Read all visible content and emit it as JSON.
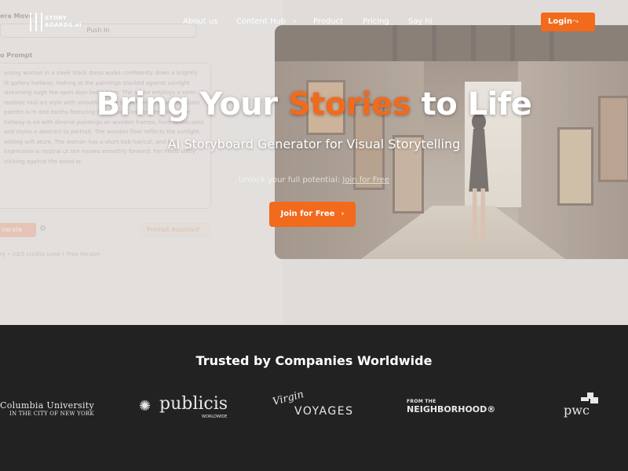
{
  "nav": {
    "logo_line1": "STORY",
    "logo_line2": "BOARDS.ai",
    "items": [
      "About us",
      "Content Hub",
      "Product",
      "Pricing",
      "Say hi"
    ],
    "content_hub_caret": "⌄",
    "login_label": "Login",
    "login_icon": "squiggle-arrow-icon"
  },
  "mockup": {
    "camera_label": "era Move",
    "motion_value": "Push In",
    "prompt_label": "o Prompt",
    "prompt_text": "young woman in a sleek black dress walks confidently down a brightly lit gallery hallway, looking at the paintings stacked against sunlight streaming ough the open door behind her. The scene employs a semi-realistic ntal art style with smooth textures and vibrant tones, the color palette is m and earthy featuring rich browns and golden hues. The hallway is ed with diverse paintings on wooden frames, from landscapes and styles n abstract to portrait. The wooden floor reflects the sunlight, adding soft ature. The woman has a short bob haircut, and her expression is neutral ut she moves smoothly forward, her heels softly clicking against the wood or.",
    "generate_label": "nerate",
    "prompt_assist_label": "Prompt Assistant",
    "credit_text": "ry • 03/5 credits used • Free Version"
  },
  "hero": {
    "title_before": "Bring Your ",
    "title_accent": "Stories",
    "title_after": " to Life",
    "subtitle": "AI Storyboard Generator for Visual Storytelling",
    "note_text": "Unlock your full potential: ",
    "note_link": "Join for Free",
    "cta_label": "Join for Free",
    "cta_icon": "chevron-right-icon"
  },
  "trusted": {
    "title": "Trusted by Companies Worldwide",
    "logos": {
      "columbia_line1": "Columbia University",
      "columbia_line2": "IN THE CITY OF NEW YORK",
      "publicis_name": "publicis",
      "publicis_sub": "WORLDWIDE",
      "virgin_script": "Virgin",
      "virgin_word": "VOYAGES",
      "hood_from": "FROM THE",
      "hood_name": "NEIGHBORHOOD®",
      "pwc_name": "pwc"
    }
  },
  "colors": {
    "accent": "#f26a1b",
    "footer_bg": "#222222"
  }
}
